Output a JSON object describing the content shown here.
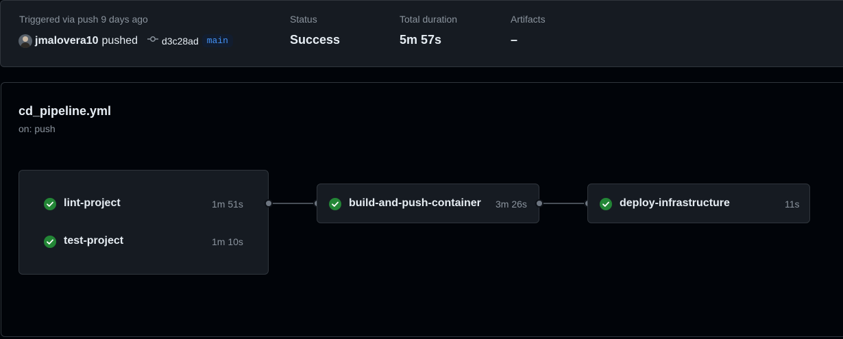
{
  "summary": {
    "trigger_text": "Triggered via push 9 days ago",
    "actor": "jmalovera10",
    "action": "pushed",
    "commit_sha": "d3c28ad",
    "branch": "main",
    "status_label": "Status",
    "status_value": "Success",
    "duration_label": "Total duration",
    "duration_value": "5m 57s",
    "artifacts_label": "Artifacts",
    "artifacts_value": "–"
  },
  "workflow": {
    "file": "cd_pipeline.yml",
    "trigger": "on: push"
  },
  "jobs": {
    "lint": {
      "name": "lint-project",
      "duration": "1m 51s",
      "status": "success"
    },
    "test": {
      "name": "test-project",
      "duration": "1m 10s",
      "status": "success"
    },
    "build": {
      "name": "build-and-push-container",
      "duration": "3m 26s",
      "status": "success"
    },
    "deploy": {
      "name": "deploy-infrastructure",
      "duration": "11s",
      "status": "success"
    }
  },
  "colors": {
    "success": "#238636",
    "branch_text": "#4493f8"
  },
  "icons": {
    "commit": "git-commit-icon",
    "success": "check-circle-icon"
  }
}
